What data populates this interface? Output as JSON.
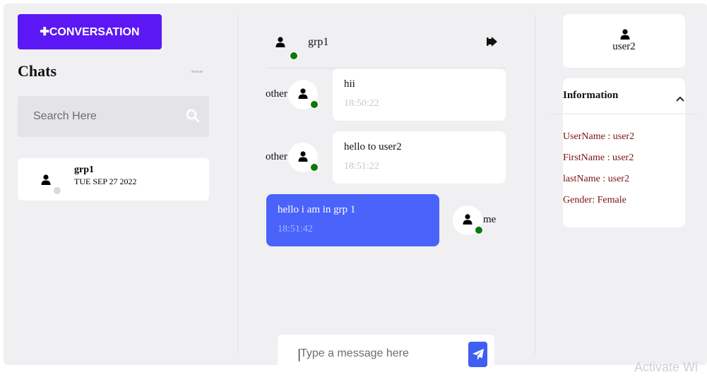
{
  "sidebar": {
    "new_conversation_label": "✚CONVERSATION",
    "chats_title": "Chats",
    "search_placeholder": "Search Here",
    "chats": [
      {
        "name": "grp1",
        "date": "TUE SEP 27 2022",
        "status": "offline"
      }
    ]
  },
  "conversation": {
    "title": "grp1",
    "messages": [
      {
        "sender": "other",
        "text": "hii",
        "time": "18:50:22",
        "direction": "incoming"
      },
      {
        "sender": "other",
        "text": "hello to user2",
        "time": "18:51:22",
        "direction": "incoming"
      },
      {
        "sender": "me",
        "text": "hello i am in grp 1",
        "time": "18:51:42",
        "direction": "outgoing"
      }
    ],
    "composer_placeholder": "Type a message here"
  },
  "profile": {
    "username": "user2",
    "info_title": "Information",
    "details": [
      "UserName : user2",
      "FirstName : user2",
      "lastName : user2",
      "Gender: Female"
    ]
  },
  "watermark": "Activate Wi",
  "colors": {
    "accent_purple": "#5b18f5",
    "outgoing_bubble": "#4a63fb",
    "send_button": "#3f5ff0",
    "online_status": "#0a7a0a",
    "info_text": "#7a1212"
  }
}
